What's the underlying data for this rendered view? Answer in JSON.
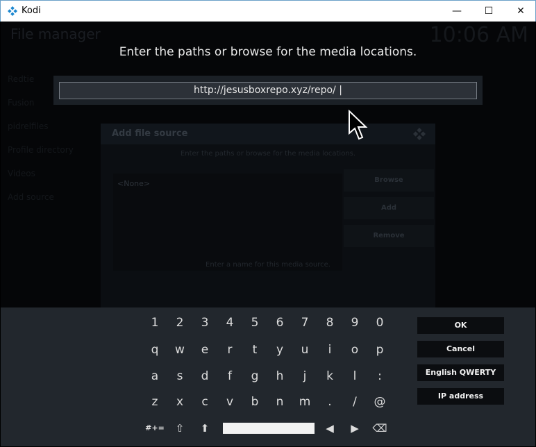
{
  "window": {
    "title": "Kodi",
    "controls": {
      "minimize": "—",
      "maximize": "☐",
      "close": "✕"
    }
  },
  "background": {
    "page_title": "File manager",
    "clock": "10:06 AM",
    "sidebar": [
      "Redtie",
      "Fusion",
      "pidrelfiles",
      "Profile directory",
      "Videos",
      "Add source"
    ],
    "dialog": {
      "title": "Add file source",
      "subtitle": "Enter the paths or browse for the media locations.",
      "list_item": "<None>",
      "buttons": [
        "Browse",
        "Add",
        "Remove"
      ],
      "name_prompt": "Enter a name for this media source."
    }
  },
  "prompt": {
    "heading": "Enter the paths or browse for the media locations.",
    "input_value": "http://jesusboxrepo.xyz/repo/ |"
  },
  "keyboard": {
    "rows": [
      [
        "1",
        "2",
        "3",
        "4",
        "5",
        "6",
        "7",
        "8",
        "9",
        "0"
      ],
      [
        "q",
        "w",
        "e",
        "r",
        "t",
        "y",
        "u",
        "i",
        "o",
        "p"
      ],
      [
        "a",
        "s",
        "d",
        "f",
        "g",
        "h",
        "j",
        "k",
        "l",
        ":"
      ],
      [
        "z",
        "x",
        "c",
        "v",
        "b",
        "n",
        "m",
        ".",
        "/",
        "@"
      ]
    ],
    "bottom_row": {
      "symbols": "#+=",
      "caps_lock": "⇧",
      "shift": "⬆",
      "left": "◀",
      "right": "▶",
      "backspace": "⌫"
    },
    "actions": {
      "ok": "OK",
      "cancel": "Cancel",
      "layout": "English QWERTY",
      "ip_address": "IP address"
    }
  },
  "colors": {
    "kodi_blue": "#1d88d0",
    "panel": "#22272d",
    "input_bg": "#2c3138"
  }
}
